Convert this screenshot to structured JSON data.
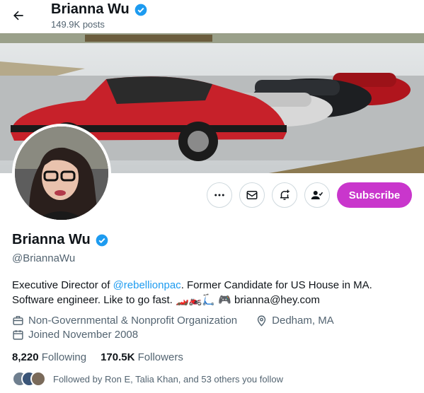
{
  "header": {
    "back_icon": "arrow-left-icon",
    "name": "Brianna Wu",
    "posts": "149.9K posts"
  },
  "actions": {
    "more_icon": "more-icon",
    "message_icon": "envelope-icon",
    "notify_icon": "bell-plus-icon",
    "following_icon": "person-check-icon",
    "subscribe_label": "Subscribe",
    "subscribe_color": "#c936cc"
  },
  "profile": {
    "name": "Brianna Wu",
    "handle": "@BriannaWu",
    "bio": {
      "prefix": "Executive Director of ",
      "link": "@rebellionpac",
      "suffix": ". Former Candidate for US House in MA. Software engineer. Like to go fast.",
      "emoji": "🏎️🏍️🛴 🎮",
      "email": " brianna@hey.com"
    },
    "category": "Non-Governmental & Nonprofit Organization",
    "location": "Dedham, MA",
    "joined": "Joined November 2008"
  },
  "stats": {
    "following_count": "8,220",
    "following_label": "Following",
    "followers_count": "170.5K",
    "followers_label": "Followers"
  },
  "followed_by": {
    "text": "Followed by Ron E, Talia Khan, and 53 others you follow"
  },
  "colors": {
    "accent": "#1d9bf0",
    "text": "#0f1419",
    "muted": "#536471"
  }
}
